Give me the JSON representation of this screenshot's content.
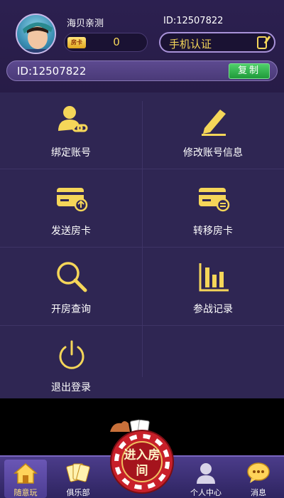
{
  "header": {
    "nickname": "海贝亲测",
    "id_text": "ID:12507822",
    "card_badge": "房卡",
    "card_count": "0",
    "auth_label": "手机认证",
    "id_bar_text": "ID:12507822",
    "copy_label": "复制"
  },
  "menu": {
    "items": [
      {
        "label": "绑定账号",
        "icon": "user-link-icon"
      },
      {
        "label": "修改账号信息",
        "icon": "edit-pen-icon"
      },
      {
        "label": "发送房卡",
        "icon": "card-send-icon"
      },
      {
        "label": "转移房卡",
        "icon": "card-transfer-icon"
      },
      {
        "label": "开房查询",
        "icon": "search-icon"
      },
      {
        "label": "参战记录",
        "icon": "bar-chart-icon"
      },
      {
        "label": "退出登录",
        "icon": "power-icon"
      }
    ]
  },
  "nav": {
    "items": [
      {
        "label": "随意玩",
        "icon": "home-icon",
        "active": true
      },
      {
        "label": "俱乐部",
        "icon": "cards-icon",
        "active": false
      },
      {
        "label": "个人中心",
        "icon": "person-icon",
        "active": false
      },
      {
        "label": "消息",
        "icon": "chat-bubble-icon",
        "active": false
      }
    ],
    "center_button": "进入房间"
  },
  "colors": {
    "accent_gold": "#f5d659",
    "panel": "#2f2653",
    "header": "#2c2050",
    "copy_green": "#2fb24c"
  }
}
